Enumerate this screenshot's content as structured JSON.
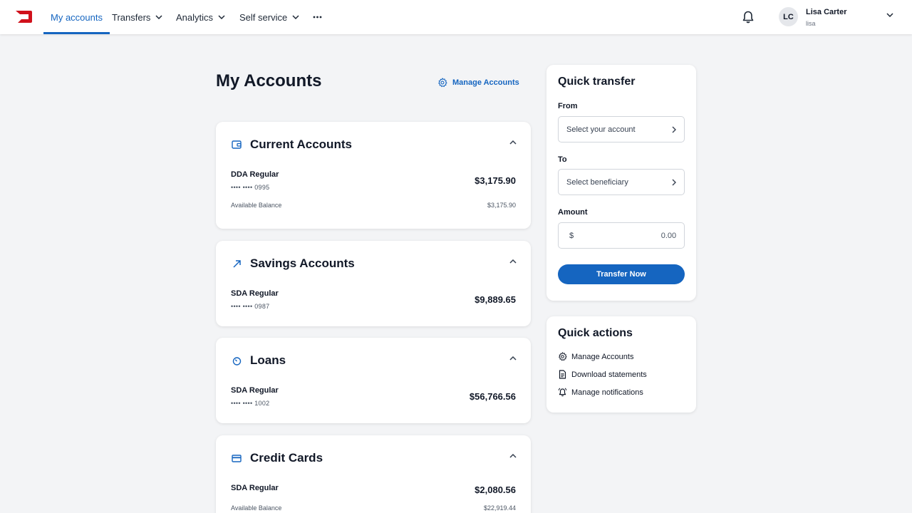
{
  "nav": {
    "logo": "bank-logo",
    "items": [
      {
        "label": "My accounts",
        "active": true
      },
      {
        "label": "Transfers",
        "has_dropdown": true
      },
      {
        "label": "Analytics",
        "has_dropdown": true
      },
      {
        "label": "Self service",
        "has_dropdown": true
      }
    ],
    "more_icon": "more-horizontal-icon",
    "bell_icon": "bell-icon",
    "user": {
      "initials": "LC",
      "name": "Lisa Carter",
      "login": "lisa"
    }
  },
  "page": {
    "title": "My Accounts",
    "manage_link": "Manage Accounts"
  },
  "accounts": [
    {
      "title": "Current Accounts",
      "icon": "wallet-icon",
      "items": [
        {
          "name": "DDA Regular",
          "mask": "•••• •••• 0995",
          "amount": "$3,175.90",
          "available_label": "Available Balance",
          "available_amount": "$3,175.90"
        }
      ]
    },
    {
      "title": "Savings Accounts",
      "icon": "trend-arrow-icon",
      "items": [
        {
          "name": "SDA Regular",
          "mask": "•••• •••• 0987",
          "amount": "$9,889.65"
        }
      ]
    },
    {
      "title": "Loans",
      "icon": "timer-icon",
      "items": [
        {
          "name": "SDA Regular",
          "mask": "•••• •••• 1002",
          "amount": "$56,766.56"
        }
      ]
    },
    {
      "title": "Credit Cards",
      "icon": "credit-card-icon",
      "items": [
        {
          "name": "SDA Regular",
          "amount": "$2,080.56",
          "available_label": "Available Balance",
          "available_amount": "$22,919.44"
        }
      ]
    }
  ],
  "quick_transfer": {
    "title": "Quick transfer",
    "from_label": "From",
    "from_placeholder": "Select your account",
    "to_label": "To",
    "to_placeholder": "Select beneficiary",
    "amount_label": "Amount",
    "currency": "$",
    "amount_value": "0.00",
    "button": "Transfer Now"
  },
  "quick_actions": {
    "title": "Quick actions",
    "items": [
      {
        "label": "Manage Accounts",
        "icon": "gear-icon"
      },
      {
        "label": "Download statements",
        "icon": "document-icon"
      },
      {
        "label": "Manage notifications",
        "icon": "bell-ring-icon"
      }
    ]
  },
  "colors": {
    "accent": "#1565c0",
    "logo": "#d0111b",
    "background": "#f3f4f6"
  }
}
